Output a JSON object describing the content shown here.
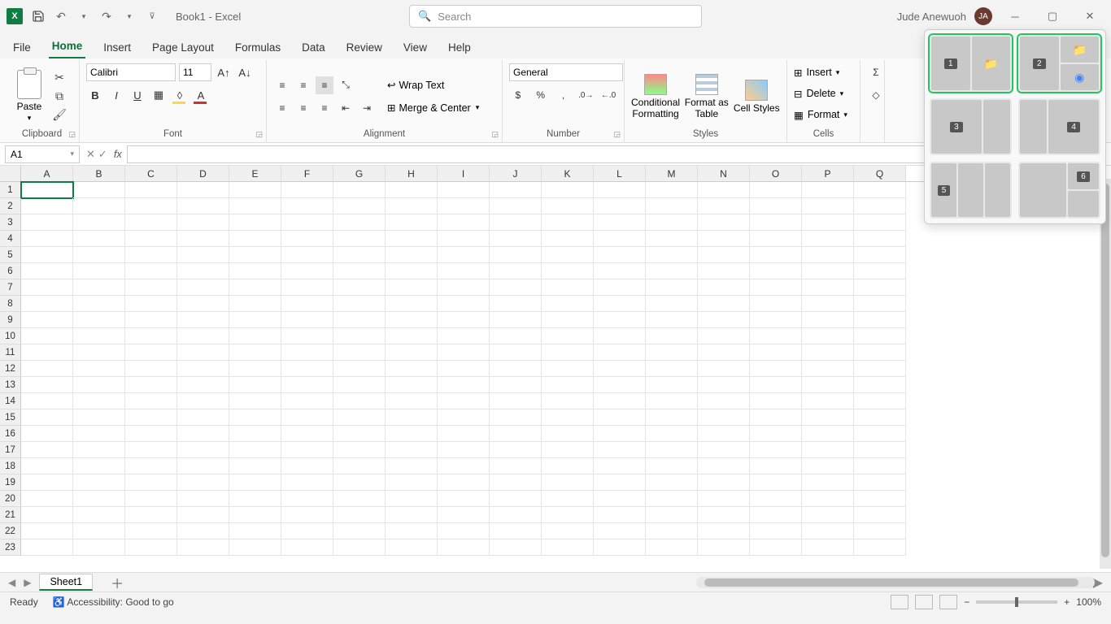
{
  "title": {
    "doc": "Book1 - Excel",
    "search_placeholder": "Search",
    "user": "Jude Anewuoh",
    "initials": "JA"
  },
  "tabs": [
    "File",
    "Home",
    "Insert",
    "Page Layout",
    "Formulas",
    "Data",
    "Review",
    "View",
    "Help"
  ],
  "active_tab": "Home",
  "ribbon": {
    "clipboard": {
      "label": "Clipboard",
      "paste": "Paste"
    },
    "font": {
      "label": "Font",
      "name": "Calibri",
      "size": "11",
      "bold": "B",
      "italic": "I",
      "underline": "U"
    },
    "alignment": {
      "label": "Alignment",
      "wrap": "Wrap Text",
      "merge": "Merge & Center"
    },
    "number": {
      "label": "Number",
      "format": "General"
    },
    "styles": {
      "label": "Styles",
      "cond": "Conditional Formatting",
      "table": "Format as Table",
      "cell": "Cell Styles"
    },
    "cells": {
      "label": "Cells",
      "insert": "Insert",
      "delete": "Delete",
      "format": "Format"
    }
  },
  "formula": {
    "name_box": "A1",
    "fx": "fx",
    "value": ""
  },
  "columns": [
    "A",
    "B",
    "C",
    "D",
    "E",
    "F",
    "G",
    "H",
    "I",
    "J",
    "K",
    "L",
    "M",
    "N",
    "O",
    "P",
    "Q"
  ],
  "rows": [
    "1",
    "2",
    "3",
    "4",
    "5",
    "6",
    "7",
    "8",
    "9",
    "10",
    "11",
    "12",
    "13",
    "14",
    "15",
    "16",
    "17",
    "18",
    "19",
    "20",
    "21",
    "22",
    "23"
  ],
  "sheet": {
    "name": "Sheet1"
  },
  "status": {
    "ready": "Ready",
    "access": "Accessibility: Good to go",
    "zoom": "100%"
  },
  "snap": {
    "n1": "1",
    "n2": "2",
    "n3": "3",
    "n4": "4",
    "n5": "5",
    "n6": "6"
  }
}
